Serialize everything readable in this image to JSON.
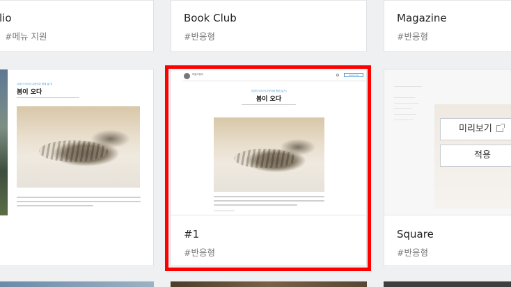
{
  "cards": [
    {
      "name": "lio",
      "tag": "#메뉴 지원"
    },
    {
      "name": "Book Club",
      "tag": "#반응형"
    },
    {
      "name": "Magazine",
      "tag": "#반응형"
    },
    {
      "name": "#1",
      "tag": "#반응형"
    },
    {
      "name": "Square",
      "tag": "#반응형"
    }
  ],
  "preview": {
    "category": "고양이 이야기(고양이와 함께 살기)",
    "title": "봄이 오다",
    "site_name": "모음고양이",
    "subscribe": "subscribe"
  },
  "buttons": {
    "preview": "미리보기",
    "apply": "적용"
  },
  "selected_theme": "#1"
}
